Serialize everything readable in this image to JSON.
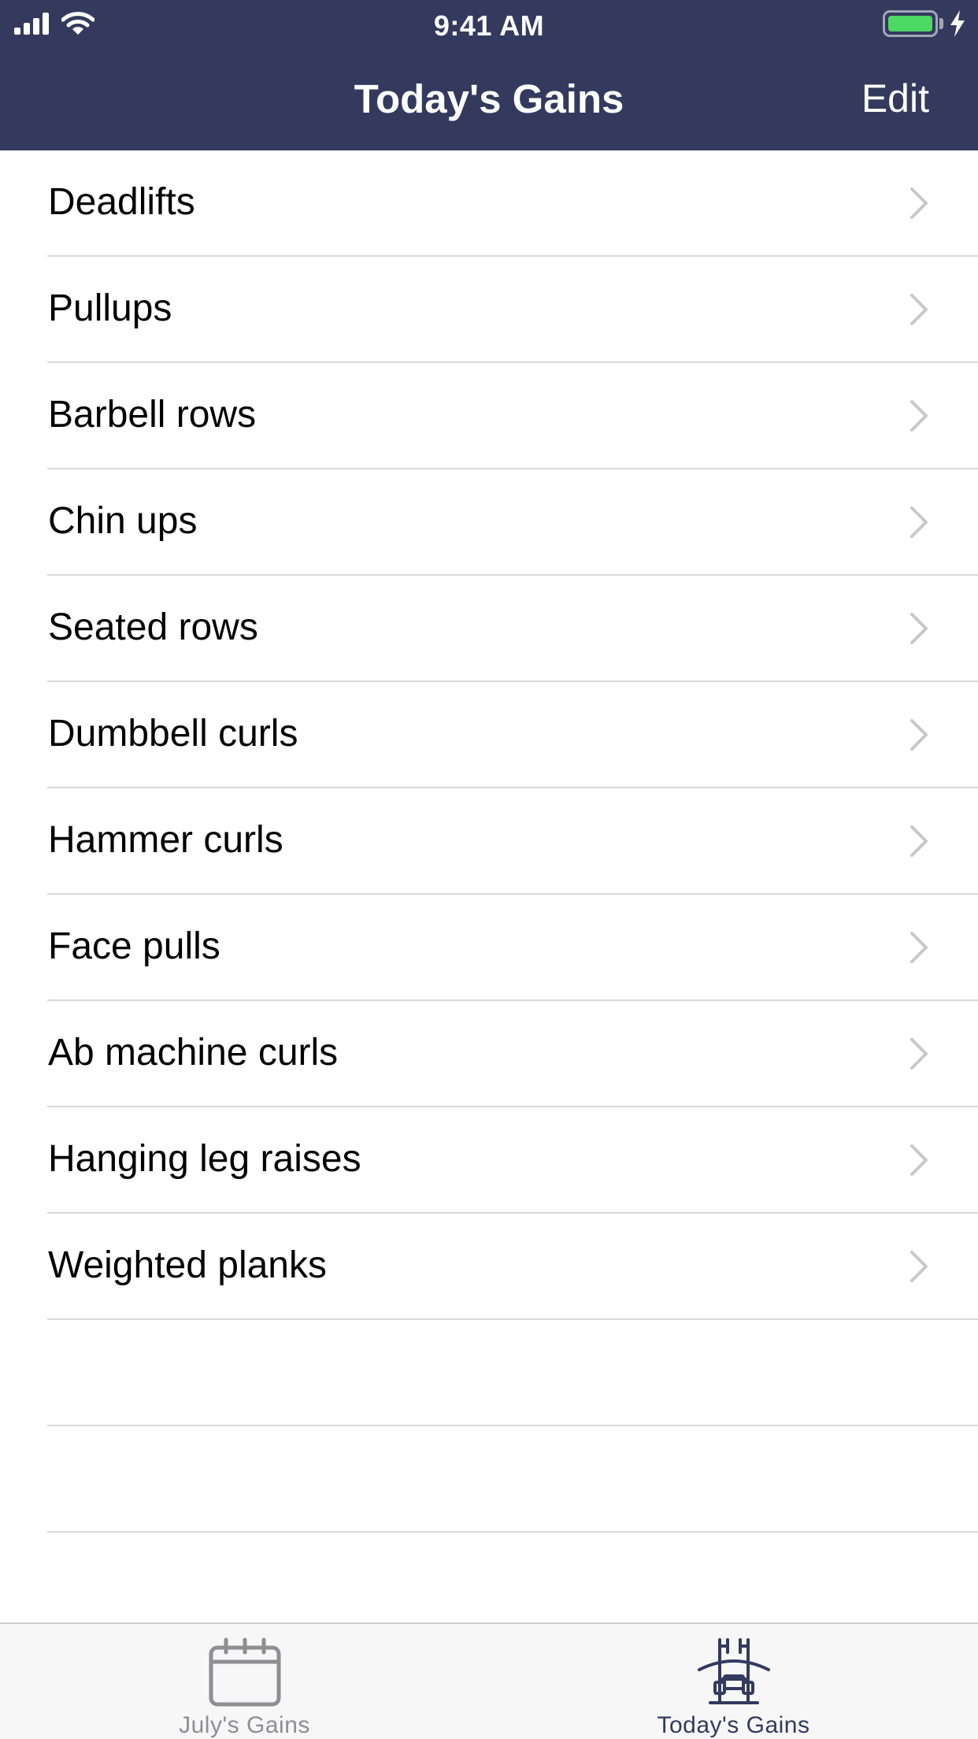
{
  "status_bar": {
    "time": "9:41 AM"
  },
  "nav": {
    "title": "Today's Gains",
    "edit_label": "Edit"
  },
  "exercises": [
    "Deadlifts",
    "Pullups",
    "Barbell rows",
    "Chin ups",
    "Seated rows",
    "Dumbbell curls",
    "Hammer curls",
    "Face pulls",
    "Ab machine curls",
    "Hanging leg raises",
    "Weighted planks"
  ],
  "tabs": [
    {
      "label": "July's Gains",
      "icon": "calendar-icon",
      "selected": false
    },
    {
      "label": "Today's Gains",
      "icon": "barbell-rack-icon",
      "selected": true
    }
  ],
  "colors": {
    "nav_background": "#343a5e",
    "battery": "#4cd964",
    "chevron": "#c7c7cc",
    "tab_inactive": "#8e8e93",
    "tab_active": "#343a5e"
  }
}
